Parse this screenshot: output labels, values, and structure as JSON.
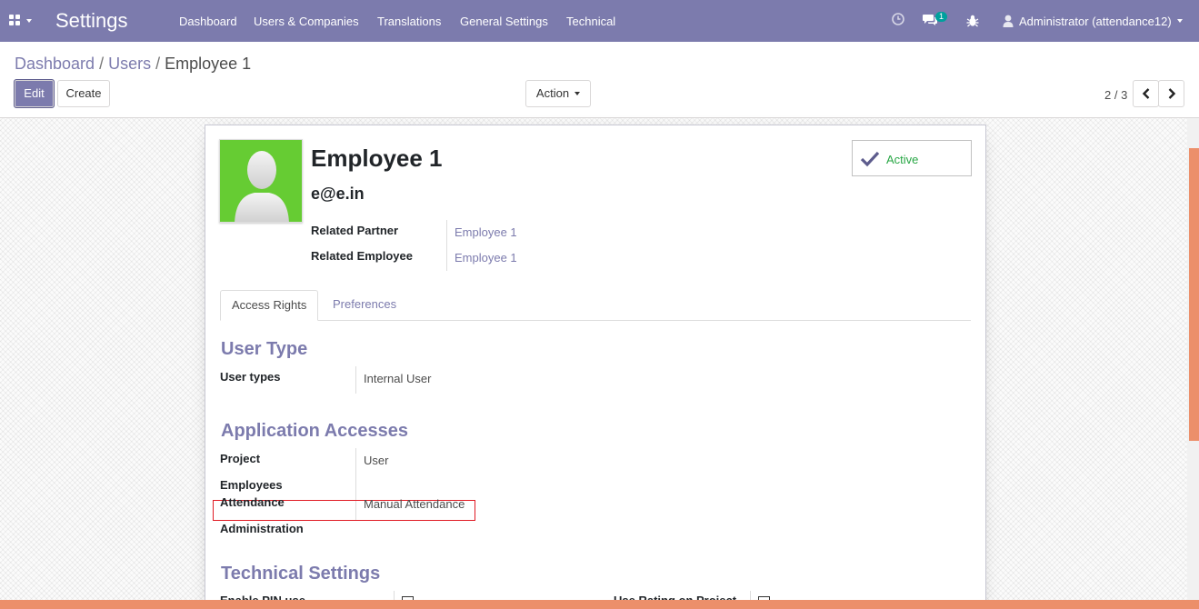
{
  "navbar": {
    "brand": "Settings",
    "menu": [
      "Dashboard",
      "Users & Companies",
      "Translations",
      "General Settings",
      "Technical"
    ],
    "messages_badge": "1",
    "user_name": "Administrator (attendance12)",
    "colors": {
      "bar": "#7c7bad",
      "badge": "#00a09d"
    }
  },
  "breadcrumb": {
    "items": [
      "Dashboard",
      "Users"
    ],
    "current": "Employee 1"
  },
  "buttons": {
    "edit": "Edit",
    "create": "Create",
    "action": "Action"
  },
  "pager": {
    "value": "2 / 3"
  },
  "record": {
    "name": "Employee 1",
    "login": "e@e.in",
    "active_label": "Active",
    "fields": [
      {
        "label": "Related Partner",
        "value": "Employee 1"
      },
      {
        "label": "Related Employee",
        "value": "Employee 1"
      }
    ]
  },
  "tabs": [
    "Access Rights",
    "Preferences"
  ],
  "user_type": {
    "title": "User Type",
    "label": "User types",
    "value": "Internal User"
  },
  "app_access": {
    "title": "Application Accesses",
    "rows": [
      {
        "label": "Project",
        "value": "User"
      },
      {
        "label": "Employees",
        "value": ""
      },
      {
        "label": "Attendance",
        "value": "Manual Attendance"
      },
      {
        "label": "Administration",
        "value": ""
      }
    ]
  },
  "technical": {
    "title": "Technical Settings",
    "left_label": "Enable PIN use",
    "right_label": "Use Rating on Project"
  },
  "colors": {
    "accent": "#7c7bad",
    "highlight": "#e01b24",
    "active": "#28a745",
    "scroll": "#ec8f6a"
  }
}
